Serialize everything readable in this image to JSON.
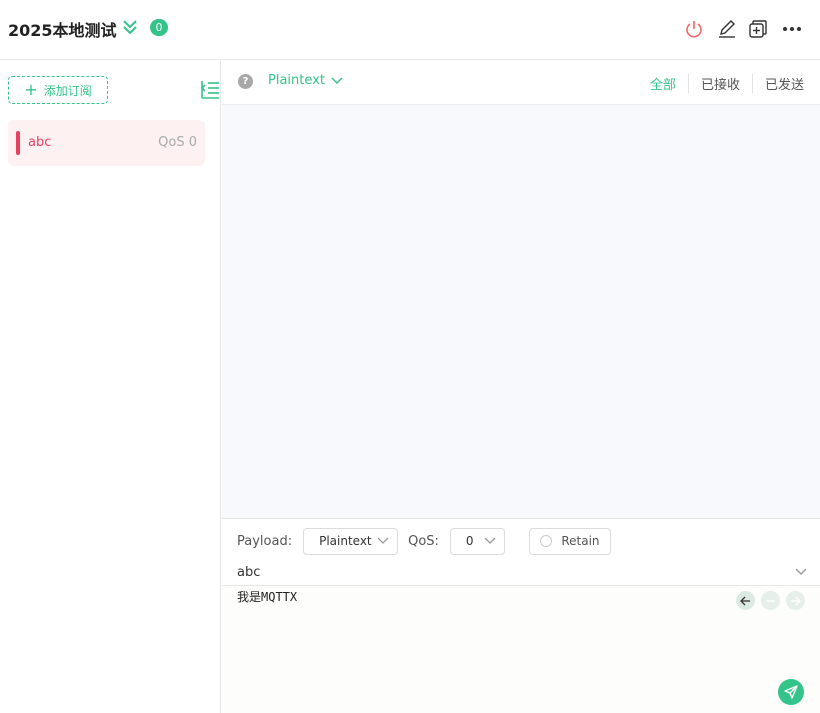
{
  "header": {
    "connection_name": "2025本地测试",
    "message_count": "0",
    "actions": [
      "disconnect",
      "edit",
      "new-window",
      "more"
    ]
  },
  "sidebar": {
    "add_subscription_label": "添加订阅",
    "subscriptions": [
      {
        "topic": "abc",
        "qos": "QoS 0",
        "color": "#e8415f"
      }
    ]
  },
  "toolbar": {
    "format": "Plaintext",
    "filters": [
      "全部",
      "已接收",
      "已发送"
    ],
    "active_filter": "全部"
  },
  "publish": {
    "payload_label": "Payload:",
    "payload_format": "Plaintext",
    "qos_label": "QoS:",
    "qos_value": "0",
    "retain_label": "Retain",
    "topic": "abc",
    "payload": "我是MQTTX"
  },
  "colors": {
    "accent": "#34c388",
    "disconnect": "#f46569",
    "subscription": "#e8415f"
  }
}
